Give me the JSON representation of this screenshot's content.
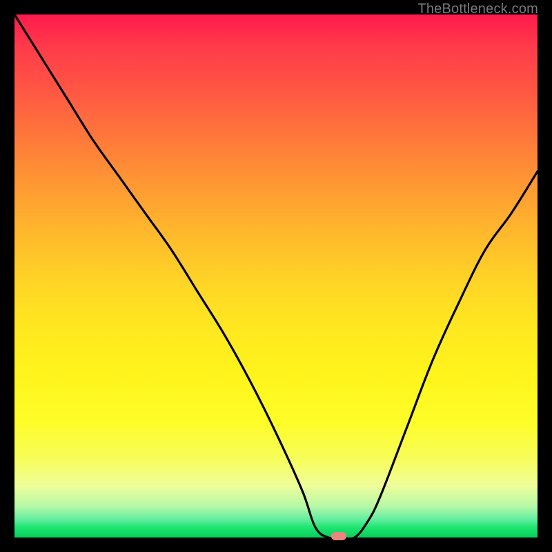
{
  "watermark": {
    "text": "TheBottleneck.com"
  },
  "chart_data": {
    "type": "line",
    "title": "",
    "xlabel": "",
    "ylabel": "",
    "xlim": [
      0,
      100
    ],
    "ylim": [
      0,
      100
    ],
    "series": [
      {
        "name": "bottleneck-curve",
        "x": [
          0,
          5,
          10,
          15,
          20,
          25,
          30,
          35,
          40,
          45,
          50,
          55,
          57.5,
          60,
          62.5,
          65,
          67.5,
          70,
          75,
          80,
          85,
          90,
          95,
          100
        ],
        "y": [
          100,
          92,
          84,
          76,
          69,
          62,
          55,
          47,
          39,
          30,
          20,
          9,
          2,
          0,
          0,
          0,
          3,
          8,
          21,
          34,
          45,
          55,
          62,
          70
        ]
      }
    ],
    "marker": {
      "x": 62,
      "y": 0
    }
  },
  "colors": {
    "curve": "#000000",
    "marker": "#e9867e",
    "background_top": "#ff1a4d",
    "background_bottom": "#06d05a"
  }
}
